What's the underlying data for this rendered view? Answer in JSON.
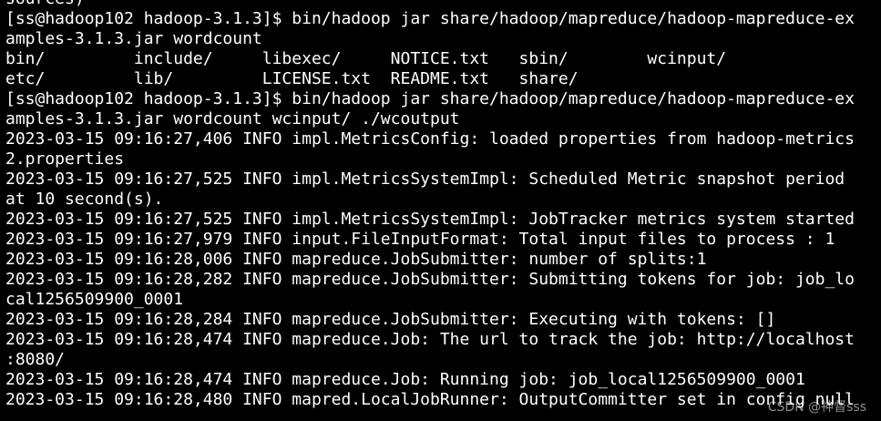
{
  "terminal": {
    "background": "#000000",
    "foreground": "#ffffff",
    "lines": [
      "sources)",
      "[ss@hadoop102 hadoop-3.1.3]$ bin/hadoop jar share/hadoop/mapreduce/hadoop-mapreduce-ex",
      "amples-3.1.3.jar wordcount",
      "bin/         include/     libexec/     NOTICE.txt   sbin/        wcinput/",
      "etc/         lib/         LICENSE.txt  README.txt   share/",
      "[ss@hadoop102 hadoop-3.1.3]$ bin/hadoop jar share/hadoop/mapreduce/hadoop-mapreduce-ex",
      "amples-3.1.3.jar wordcount wcinput/ ./wcoutput",
      "2023-03-15 09:16:27,406 INFO impl.MetricsConfig: loaded properties from hadoop-metrics",
      "2.properties",
      "2023-03-15 09:16:27,525 INFO impl.MetricsSystemImpl: Scheduled Metric snapshot period",
      "at 10 second(s).",
      "2023-03-15 09:16:27,525 INFO impl.MetricsSystemImpl: JobTracker metrics system started",
      "2023-03-15 09:16:27,979 INFO input.FileInputFormat: Total input files to process : 1",
      "2023-03-15 09:16:28,006 INFO mapreduce.JobSubmitter: number of splits:1",
      "2023-03-15 09:16:28,282 INFO mapreduce.JobSubmitter: Submitting tokens for job: job_lo",
      "cal1256509900_0001",
      "2023-03-15 09:16:28,284 INFO mapreduce.JobSubmitter: Executing with tokens: []",
      "2023-03-15 09:16:28,474 INFO mapreduce.Job: The url to track the job: http://localhost",
      ":8080/",
      "2023-03-15 09:16:28,474 INFO mapreduce.Job: Running job: job_local1256509900_0001",
      "2023-03-15 09:16:28,480 INFO mapred.LocalJobRunner: OutputCommitter set in config null"
    ]
  },
  "watermark": "CSDN @神督sss"
}
